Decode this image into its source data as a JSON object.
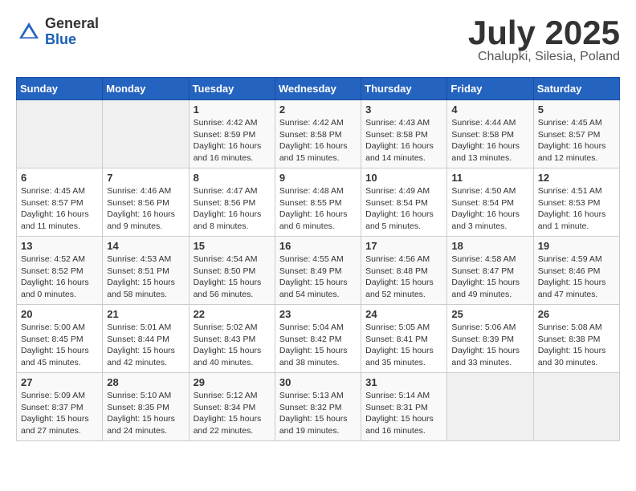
{
  "header": {
    "logo_general": "General",
    "logo_blue": "Blue",
    "month": "July 2025",
    "location": "Chalupki, Silesia, Poland"
  },
  "days_of_week": [
    "Sunday",
    "Monday",
    "Tuesday",
    "Wednesday",
    "Thursday",
    "Friday",
    "Saturday"
  ],
  "weeks": [
    [
      {
        "day": "",
        "info": ""
      },
      {
        "day": "",
        "info": ""
      },
      {
        "day": "1",
        "info": "Sunrise: 4:42 AM\nSunset: 8:59 PM\nDaylight: 16 hours and 16 minutes."
      },
      {
        "day": "2",
        "info": "Sunrise: 4:42 AM\nSunset: 8:58 PM\nDaylight: 16 hours and 15 minutes."
      },
      {
        "day": "3",
        "info": "Sunrise: 4:43 AM\nSunset: 8:58 PM\nDaylight: 16 hours and 14 minutes."
      },
      {
        "day": "4",
        "info": "Sunrise: 4:44 AM\nSunset: 8:58 PM\nDaylight: 16 hours and 13 minutes."
      },
      {
        "day": "5",
        "info": "Sunrise: 4:45 AM\nSunset: 8:57 PM\nDaylight: 16 hours and 12 minutes."
      }
    ],
    [
      {
        "day": "6",
        "info": "Sunrise: 4:45 AM\nSunset: 8:57 PM\nDaylight: 16 hours and 11 minutes."
      },
      {
        "day": "7",
        "info": "Sunrise: 4:46 AM\nSunset: 8:56 PM\nDaylight: 16 hours and 9 minutes."
      },
      {
        "day": "8",
        "info": "Sunrise: 4:47 AM\nSunset: 8:56 PM\nDaylight: 16 hours and 8 minutes."
      },
      {
        "day": "9",
        "info": "Sunrise: 4:48 AM\nSunset: 8:55 PM\nDaylight: 16 hours and 6 minutes."
      },
      {
        "day": "10",
        "info": "Sunrise: 4:49 AM\nSunset: 8:54 PM\nDaylight: 16 hours and 5 minutes."
      },
      {
        "day": "11",
        "info": "Sunrise: 4:50 AM\nSunset: 8:54 PM\nDaylight: 16 hours and 3 minutes."
      },
      {
        "day": "12",
        "info": "Sunrise: 4:51 AM\nSunset: 8:53 PM\nDaylight: 16 hours and 1 minute."
      }
    ],
    [
      {
        "day": "13",
        "info": "Sunrise: 4:52 AM\nSunset: 8:52 PM\nDaylight: 16 hours and 0 minutes."
      },
      {
        "day": "14",
        "info": "Sunrise: 4:53 AM\nSunset: 8:51 PM\nDaylight: 15 hours and 58 minutes."
      },
      {
        "day": "15",
        "info": "Sunrise: 4:54 AM\nSunset: 8:50 PM\nDaylight: 15 hours and 56 minutes."
      },
      {
        "day": "16",
        "info": "Sunrise: 4:55 AM\nSunset: 8:49 PM\nDaylight: 15 hours and 54 minutes."
      },
      {
        "day": "17",
        "info": "Sunrise: 4:56 AM\nSunset: 8:48 PM\nDaylight: 15 hours and 52 minutes."
      },
      {
        "day": "18",
        "info": "Sunrise: 4:58 AM\nSunset: 8:47 PM\nDaylight: 15 hours and 49 minutes."
      },
      {
        "day": "19",
        "info": "Sunrise: 4:59 AM\nSunset: 8:46 PM\nDaylight: 15 hours and 47 minutes."
      }
    ],
    [
      {
        "day": "20",
        "info": "Sunrise: 5:00 AM\nSunset: 8:45 PM\nDaylight: 15 hours and 45 minutes."
      },
      {
        "day": "21",
        "info": "Sunrise: 5:01 AM\nSunset: 8:44 PM\nDaylight: 15 hours and 42 minutes."
      },
      {
        "day": "22",
        "info": "Sunrise: 5:02 AM\nSunset: 8:43 PM\nDaylight: 15 hours and 40 minutes."
      },
      {
        "day": "23",
        "info": "Sunrise: 5:04 AM\nSunset: 8:42 PM\nDaylight: 15 hours and 38 minutes."
      },
      {
        "day": "24",
        "info": "Sunrise: 5:05 AM\nSunset: 8:41 PM\nDaylight: 15 hours and 35 minutes."
      },
      {
        "day": "25",
        "info": "Sunrise: 5:06 AM\nSunset: 8:39 PM\nDaylight: 15 hours and 33 minutes."
      },
      {
        "day": "26",
        "info": "Sunrise: 5:08 AM\nSunset: 8:38 PM\nDaylight: 15 hours and 30 minutes."
      }
    ],
    [
      {
        "day": "27",
        "info": "Sunrise: 5:09 AM\nSunset: 8:37 PM\nDaylight: 15 hours and 27 minutes."
      },
      {
        "day": "28",
        "info": "Sunrise: 5:10 AM\nSunset: 8:35 PM\nDaylight: 15 hours and 24 minutes."
      },
      {
        "day": "29",
        "info": "Sunrise: 5:12 AM\nSunset: 8:34 PM\nDaylight: 15 hours and 22 minutes."
      },
      {
        "day": "30",
        "info": "Sunrise: 5:13 AM\nSunset: 8:32 PM\nDaylight: 15 hours and 19 minutes."
      },
      {
        "day": "31",
        "info": "Sunrise: 5:14 AM\nSunset: 8:31 PM\nDaylight: 15 hours and 16 minutes."
      },
      {
        "day": "",
        "info": ""
      },
      {
        "day": "",
        "info": ""
      }
    ]
  ]
}
